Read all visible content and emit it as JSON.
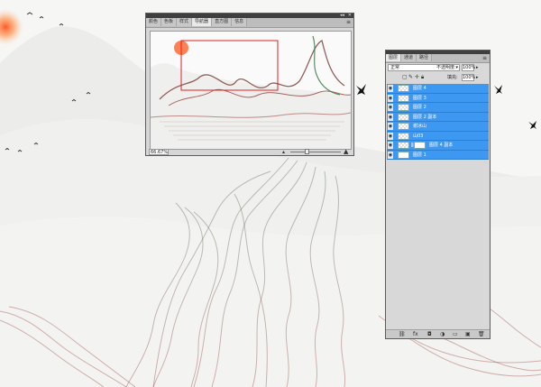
{
  "navigator": {
    "tabs": [
      "颜色",
      "色板",
      "样式",
      "导航器",
      "直方图",
      "信息"
    ],
    "active_tab": "导航器",
    "menu_icon": "panel-menu-icon",
    "zoom_value": "66.67%",
    "zoom_out_icon": "small-mountain-icon",
    "zoom_in_icon": "large-mountain-icon"
  },
  "layers": {
    "tabs": [
      "图层",
      "通道",
      "路径"
    ],
    "active_tab": "图层",
    "blend_mode": "正常",
    "opacity_label": "不透明度:",
    "opacity_value": "100%",
    "fill_label": "填充:",
    "fill_value": "100%",
    "items": [
      {
        "name": "图层 4"
      },
      {
        "name": "图层 3"
      },
      {
        "name": "图层 2"
      },
      {
        "name": "图层 2 副本"
      },
      {
        "name": "谢冰山"
      },
      {
        "name": "山03"
      },
      {
        "name": "图层 4 副本"
      },
      {
        "name": "图层 1"
      }
    ],
    "footer_icons": [
      "link-icon",
      "fx-icon",
      "mask-icon",
      "adjustment-icon",
      "group-icon",
      "new-layer-icon",
      "trash-icon"
    ]
  },
  "colors": {
    "selection": "#3d98f1",
    "ink_red": "#8c2a24",
    "ink_green": "#3d5a3a"
  }
}
